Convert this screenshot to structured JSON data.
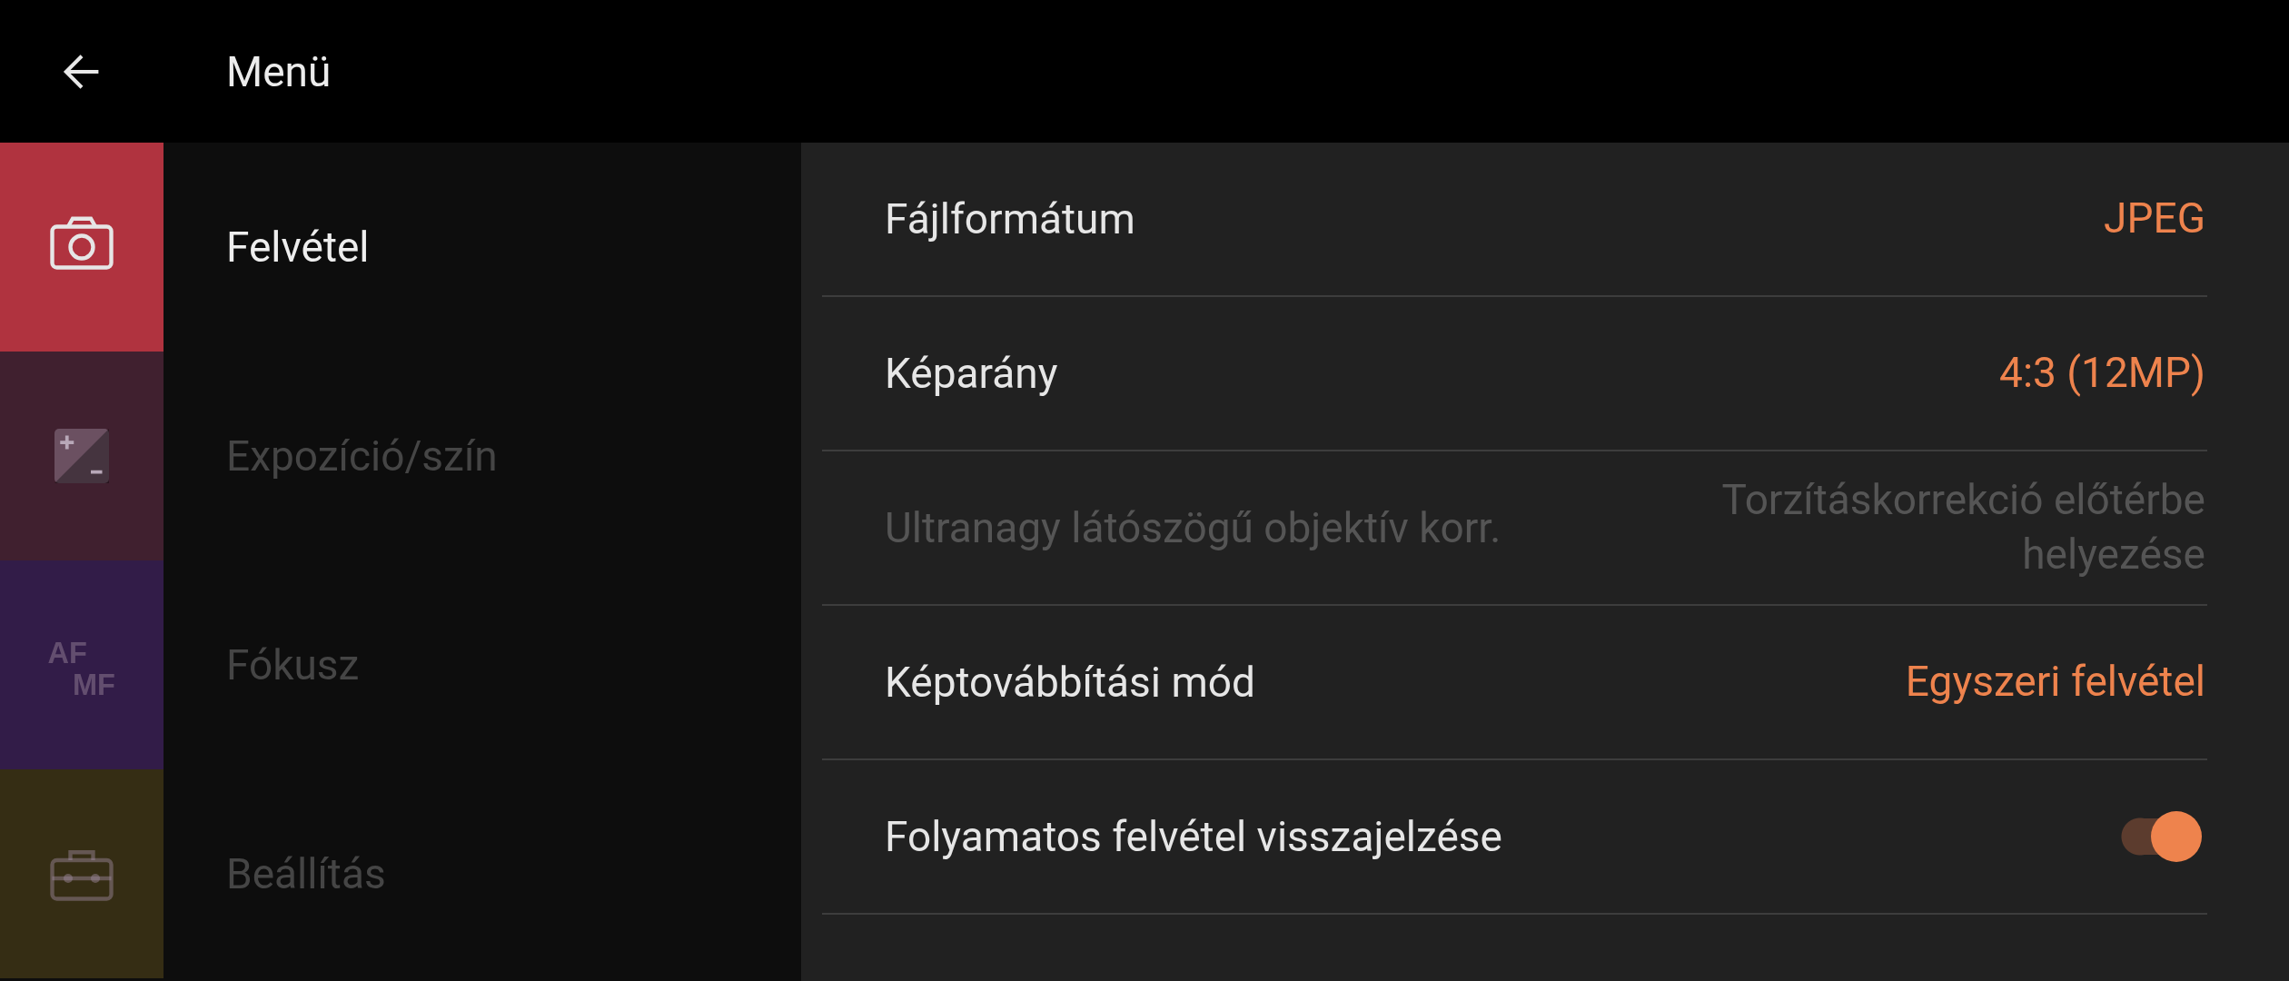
{
  "header": {
    "title": "Menü"
  },
  "categories": [
    {
      "label": "Felvétel",
      "kind": "camera",
      "color": "#b0333f",
      "selected": true
    },
    {
      "label": "Expozíció/szín",
      "kind": "exposure",
      "color": "#40202f",
      "selected": false
    },
    {
      "label": "Fókusz",
      "kind": "focus",
      "icon_text": [
        "AF",
        "MF"
      ],
      "color": "#321c48",
      "selected": false
    },
    {
      "label": "Beállítás",
      "kind": "toolbox",
      "color": "#352d14",
      "selected": false
    }
  ],
  "settings": [
    {
      "kind": "value",
      "label": "Fájlformátum",
      "value": "JPEG",
      "disabled": false
    },
    {
      "kind": "value",
      "label": "Képarány",
      "value": "4:3 (12MP)",
      "disabled": false
    },
    {
      "kind": "value",
      "label": "Ultranagy látószögű objektív korr.",
      "value": "Torzításkorrekció előtérbe helyezése",
      "disabled": true
    },
    {
      "kind": "value",
      "label": "Képtovábbítási mód",
      "value": "Egyszeri felvétel",
      "disabled": false
    },
    {
      "kind": "toggle",
      "label": "Folyamatos felvétel visszajelzése",
      "on": true,
      "disabled": false
    }
  ]
}
